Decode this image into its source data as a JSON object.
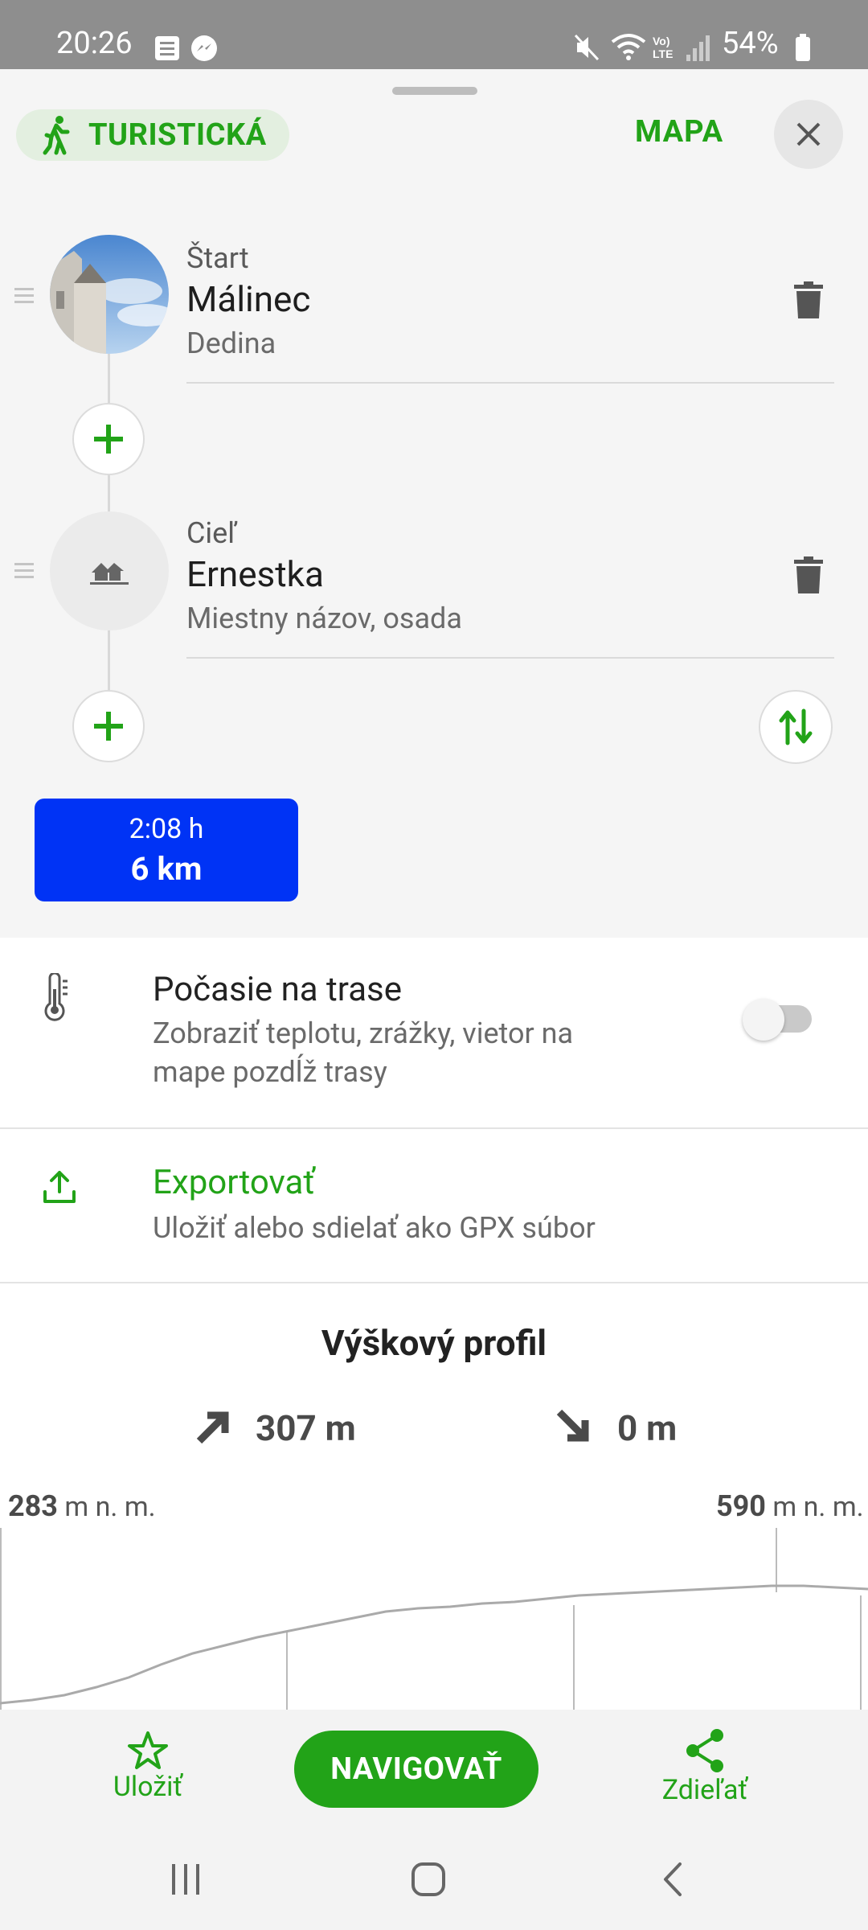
{
  "status_bar": {
    "time": "20:26",
    "battery": "54%"
  },
  "header": {
    "mode_label": "TURISTICKÁ",
    "map_label": "MAPA"
  },
  "route": {
    "start": {
      "label": "Štart",
      "name": "Málinec",
      "type": "Dedina"
    },
    "destination": {
      "label": "Cieľ",
      "name": "Ernestka",
      "type": "Miestny názov, osada"
    }
  },
  "summary": {
    "duration": "2:08 h",
    "distance": "6 km"
  },
  "weather": {
    "title": "Počasie na trase",
    "description_line1": "Zobraziť teplotu, zrážky, vietor na",
    "description_line2": "mape pozdĺž trasy",
    "enabled": false
  },
  "export": {
    "title": "Exportovať",
    "description": "Uložiť alebo sdielať ako GPX súbor"
  },
  "elevation": {
    "title": "Výškový profil",
    "ascent": "307 m",
    "descent": "0 m",
    "min_value": "283",
    "max_value": "590",
    "unit": "m n. m."
  },
  "bottom_bar": {
    "save_label": "Uložiť",
    "navigate_label": "NAVIGOVAŤ",
    "share_label": "Zdieľať"
  },
  "colors": {
    "accent": "#22a318",
    "summary": "#0033f5"
  }
}
